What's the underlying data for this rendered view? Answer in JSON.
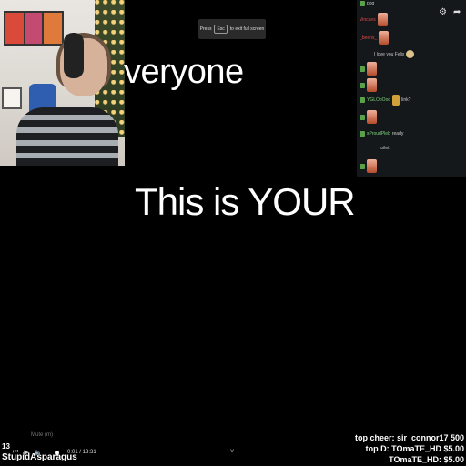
{
  "fullscreen_hint": {
    "prefix": "Press",
    "key": "Esc",
    "suffix": "to exit full screen"
  },
  "captions": {
    "line1": "veryone",
    "line2": "This is YOUR"
  },
  "chat": {
    "controls": {
      "settings_icon": "gear-icon",
      "popout_icon": "share-arrow-icon"
    },
    "messages": [
      {
        "user": "",
        "text": "pog"
      },
      {
        "user": "Vincaes",
        "text": ""
      },
      {
        "user": "_beens_",
        "text": ""
      },
      {
        "user": "",
        "text": "I love you Felix"
      },
      {
        "user": "",
        "text": ""
      },
      {
        "user": "",
        "text": ""
      },
      {
        "user": "YGLOoOoo",
        "text": "link?"
      },
      {
        "user": "",
        "text": ""
      },
      {
        "user": "sProudPleb",
        "text": "ready"
      },
      {
        "user": "",
        "text": "toilet"
      },
      {
        "user": "",
        "text": ""
      }
    ]
  },
  "player": {
    "mute_label": "Mute (m)",
    "viewer_count": "13",
    "username": "StupidAsparagus",
    "time": "0:01 / 13:31",
    "chevron": "˅"
  },
  "donations": {
    "top_cheer": "top cheer: sir_connor17 500",
    "top_d1": "top D: TOmaTE_HD $5.00",
    "top_d2": "TOmaTE_HD: $5.00"
  }
}
